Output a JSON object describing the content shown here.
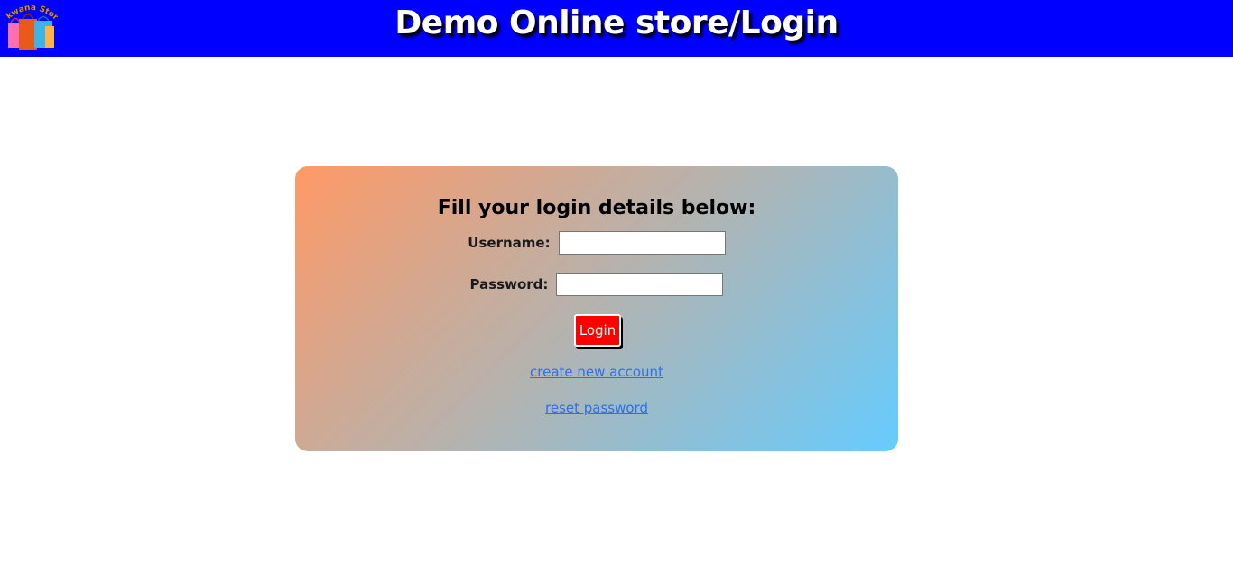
{
  "header": {
    "logo_text": "Nkwana Store",
    "title": "Demo Online store/Login",
    "background_color": "#0000ff"
  },
  "login_form": {
    "heading": "Fill your login details below:",
    "username_label": "Username:",
    "username_value": "",
    "password_label": "Password:",
    "password_value": "",
    "login_button_label": "Login",
    "login_button_color": "#ff0000",
    "create_account_link": "create new account",
    "reset_password_link": "reset password",
    "link_color": "#2f6fe8"
  },
  "icons": {
    "logo": "shopping-bags-logo-icon"
  }
}
